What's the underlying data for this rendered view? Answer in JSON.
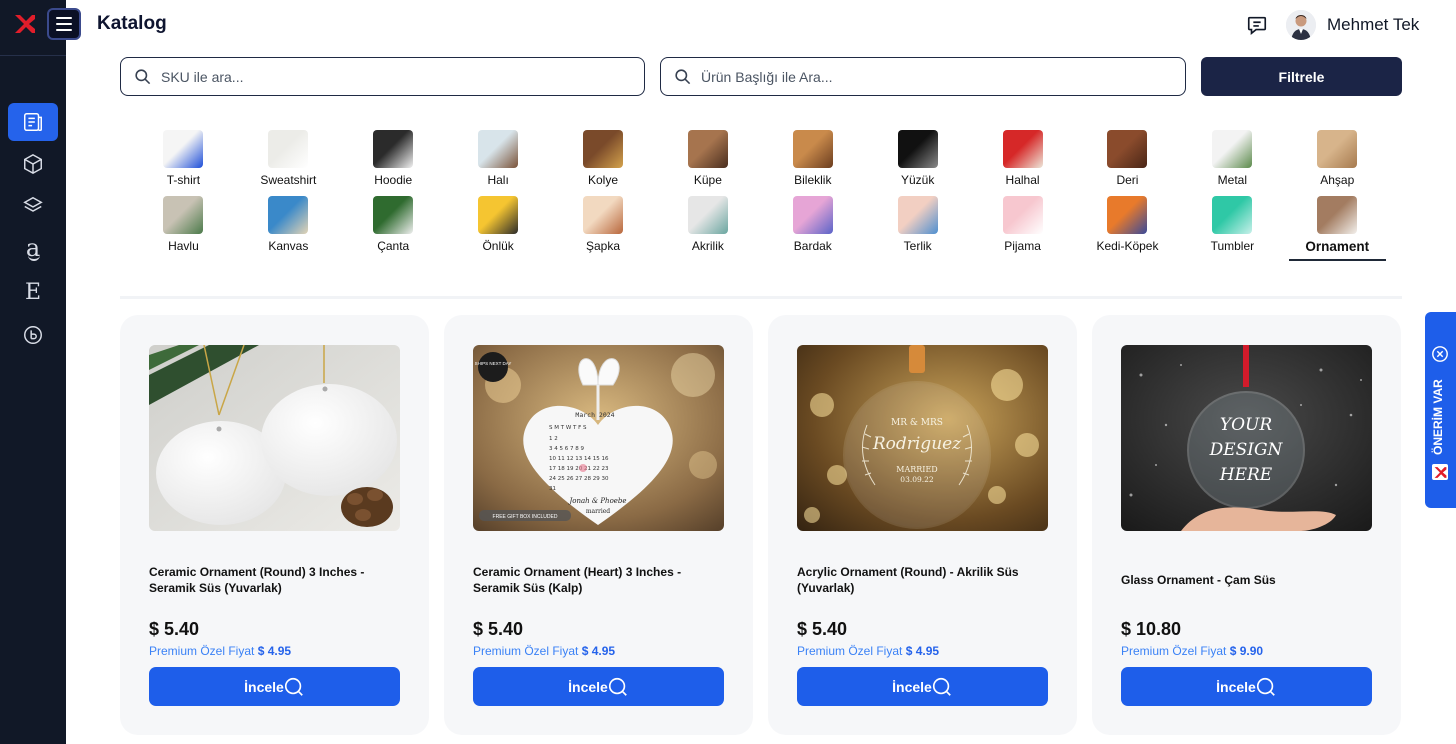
{
  "header": {
    "title": "Katalog",
    "user_name": "Mehmet Tek"
  },
  "search": {
    "sku_placeholder": "SKU ile ara...",
    "title_placeholder": "Ürün Başlığı ile Ara...",
    "filter_label": "Filtrele"
  },
  "sidebar": {
    "items": [
      {
        "icon": "catalog-icon",
        "active": true
      },
      {
        "icon": "box-icon"
      },
      {
        "icon": "layers-icon"
      },
      {
        "icon": "amazon-icon",
        "label": "a"
      },
      {
        "icon": "etsy-icon",
        "label": "E"
      },
      {
        "icon": "brand-icon"
      }
    ]
  },
  "categories": [
    {
      "label": "T-shirt",
      "colors": [
        "#f5f5f5",
        "#1d4ed8"
      ]
    },
    {
      "label": "Sweatshirt",
      "colors": [
        "#ecece8",
        "#ffffff"
      ]
    },
    {
      "label": "Hoodie",
      "colors": [
        "#2b2b2b",
        "#f2f2f2"
      ]
    },
    {
      "label": "Halı",
      "colors": [
        "#d8e4ea",
        "#7a5238"
      ]
    },
    {
      "label": "Kolye",
      "colors": [
        "#7a4a2a",
        "#d4a24c"
      ]
    },
    {
      "label": "Küpe",
      "colors": [
        "#a6744e",
        "#4a2e1f"
      ]
    },
    {
      "label": "Bileklik",
      "colors": [
        "#c98a4b",
        "#6b3d1f"
      ]
    },
    {
      "label": "Yüzük",
      "colors": [
        "#111111",
        "#8a8a8a"
      ]
    },
    {
      "label": "Halhal",
      "colors": [
        "#d62828",
        "#ede6d9"
      ]
    },
    {
      "label": "Deri",
      "colors": [
        "#8a4b2c",
        "#4a2617"
      ]
    },
    {
      "label": "Metal",
      "colors": [
        "#f3f3f3",
        "#5b8a4b"
      ]
    },
    {
      "label": "Ahşap",
      "colors": [
        "#d7b48b",
        "#a67a4e"
      ]
    },
    {
      "label": "Havlu",
      "colors": [
        "#c8c2b4",
        "#4b7a4a"
      ]
    },
    {
      "label": "Kanvas",
      "colors": [
        "#3a89c9",
        "#e3d4b5"
      ]
    },
    {
      "label": "Çanta",
      "colors": [
        "#2f6b2f",
        "#efefef"
      ]
    },
    {
      "label": "Önlük",
      "colors": [
        "#f5c531",
        "#2b2b2b"
      ]
    },
    {
      "label": "Şapka",
      "colors": [
        "#f2d9c0",
        "#b8663b"
      ]
    },
    {
      "label": "Akrilik",
      "colors": [
        "#e6e6e6",
        "#6aa6a0"
      ]
    },
    {
      "label": "Bardak",
      "colors": [
        "#e6a5d6",
        "#5a63c8"
      ]
    },
    {
      "label": "Terlik",
      "colors": [
        "#f2cfc2",
        "#4e8fd0"
      ]
    },
    {
      "label": "Pijama",
      "colors": [
        "#f7c7cf",
        "#ffffff"
      ]
    },
    {
      "label": "Kedi-Köpek",
      "colors": [
        "#e87a2b",
        "#3a4a9a"
      ]
    },
    {
      "label": "Tumbler",
      "colors": [
        "#2fc8a6",
        "#c8f0ea"
      ]
    },
    {
      "label": "Ornament",
      "colors": [
        "#a37c61",
        "#f3f0ec"
      ],
      "selected": true
    }
  ],
  "products": [
    {
      "title": "Ceramic Ornament (Round) 3 Inches - Seramik Süs (Yuvarlak)",
      "price": "$ 5.40",
      "premium_label": "Premium Özel Fiyat",
      "premium_price": "$ 4.95",
      "button": "İncele"
    },
    {
      "title": "Ceramic Ornament (Heart) 3 Inches - Seramik Süs (Kalp)",
      "price": "$ 5.40",
      "premium_label": "Premium Özel Fiyat",
      "premium_price": "$ 4.95",
      "button": "İncele",
      "image_text": {
        "badge": "SHIPS NEXT DAY",
        "month": "March 2024",
        "names": "Jonah & Phoebe",
        "married": "married",
        "gift": "FREE GIFT BOX INCLUDED"
      }
    },
    {
      "title": "Acrylic Ornament (Round) - Akrilik Süs (Yuvarlak)",
      "price": "$ 5.40",
      "premium_label": "Premium Özel Fiyat",
      "premium_price": "$ 4.95",
      "button": "İncele",
      "image_text": {
        "top": "MR & MRS",
        "name": "Rodriguez",
        "married": "MARRIED",
        "date": "03.09.22"
      }
    },
    {
      "title": "Glass Ornament - Çam Süs",
      "price": "$ 10.80",
      "premium_label": "Premium Özel Fiyat",
      "premium_price": "$ 9.90",
      "button": "İncele",
      "image_text": {
        "line1": "YOUR",
        "line2": "DESIGN",
        "line3": "HERE"
      }
    }
  ],
  "suggestion_tab": {
    "label": "ÖNERİM VAR"
  },
  "colors": {
    "sidebar_bg": "#111827",
    "accent": "#1e5eea",
    "filter_btn": "#1b2446",
    "premium": "#3b82f6"
  }
}
